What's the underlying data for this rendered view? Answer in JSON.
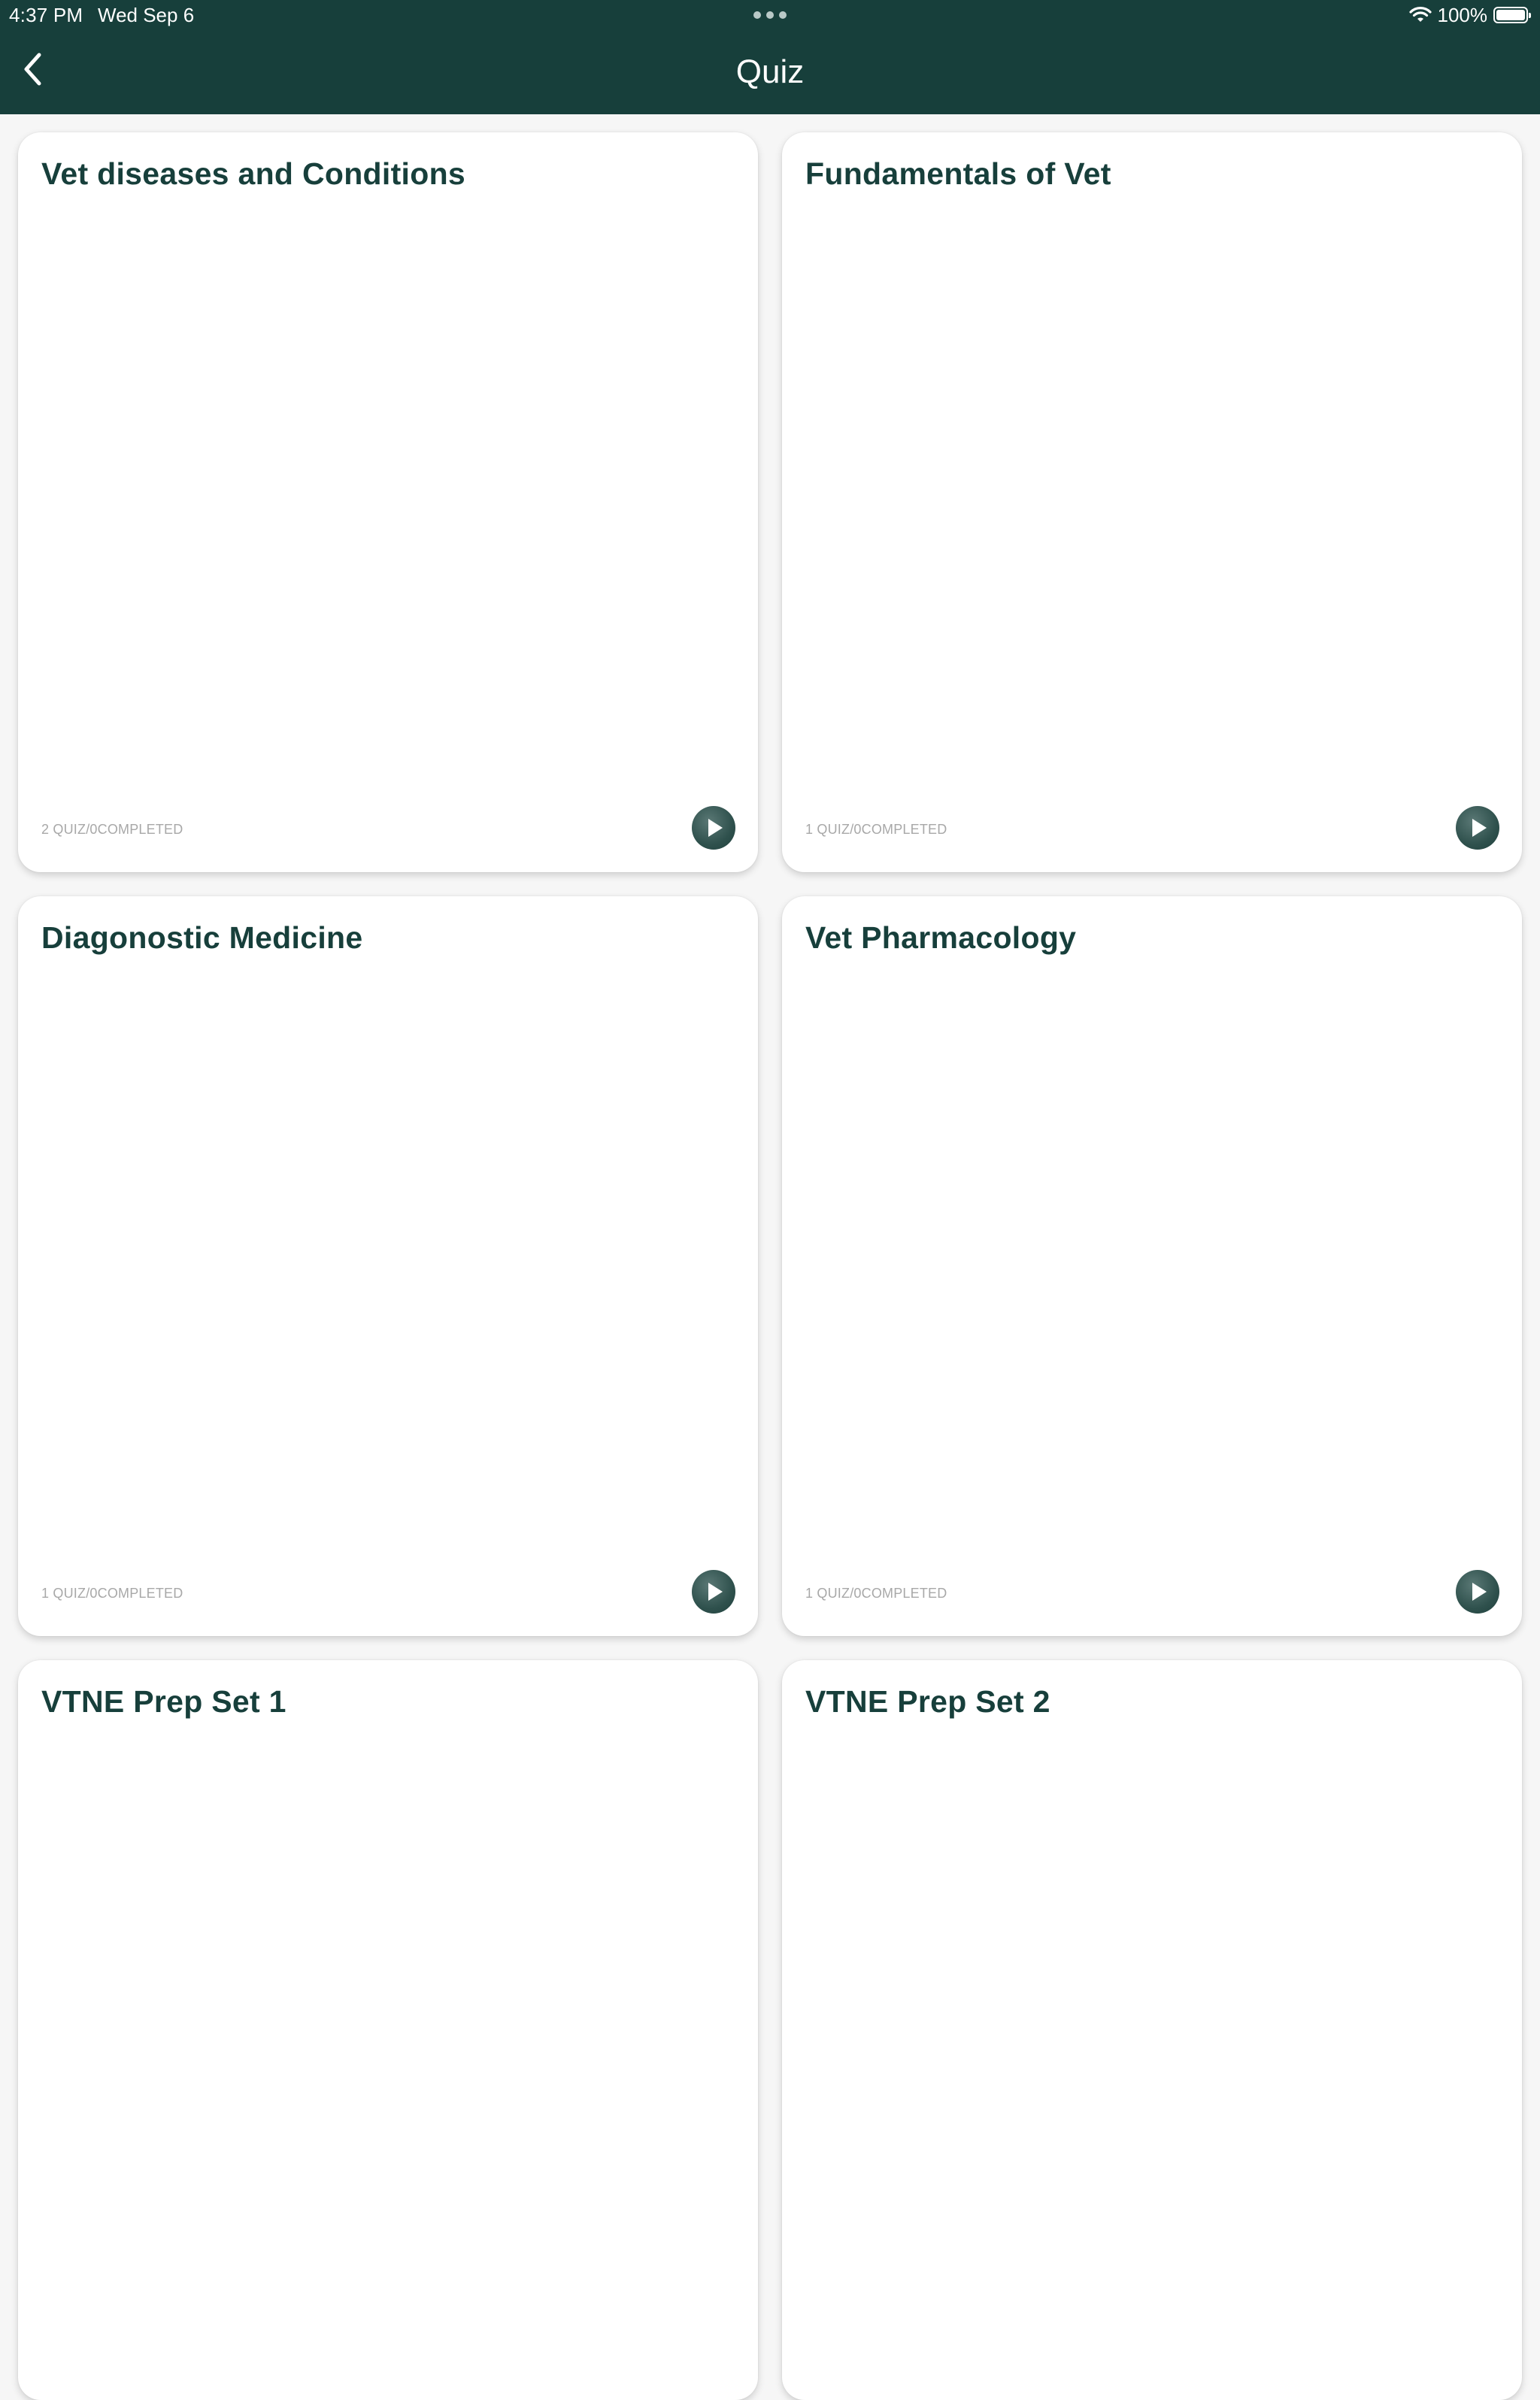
{
  "status_bar": {
    "time": "4:37 PM",
    "date": "Wed Sep 6",
    "battery": "100%",
    "wifi_icon": "wifi-icon",
    "battery_icon": "battery-icon"
  },
  "nav": {
    "back_icon": "chevron-left-icon",
    "title": "Quiz"
  },
  "colors": {
    "header_bg": "#173f3b",
    "title_text": "#173f3b",
    "card_bg": "#ffffff",
    "progress_text": "#a8a8a8",
    "play_button": "#2f514d"
  },
  "cards": [
    {
      "title": "Vet diseases and Conditions",
      "progress": "2 QUIZ/0COMPLETED",
      "action_icon": "play-icon"
    },
    {
      "title": "Fundamentals of Vet",
      "progress": "1 QUIZ/0COMPLETED",
      "action_icon": "play-icon"
    },
    {
      "title": "Diagonostic Medicine",
      "progress": "1 QUIZ/0COMPLETED",
      "action_icon": "play-icon"
    },
    {
      "title": "Vet Pharmacology",
      "progress": "1 QUIZ/0COMPLETED",
      "action_icon": "play-icon"
    },
    {
      "title": "VTNE Prep Set 1"
    },
    {
      "title": "VTNE Prep Set 2"
    }
  ]
}
